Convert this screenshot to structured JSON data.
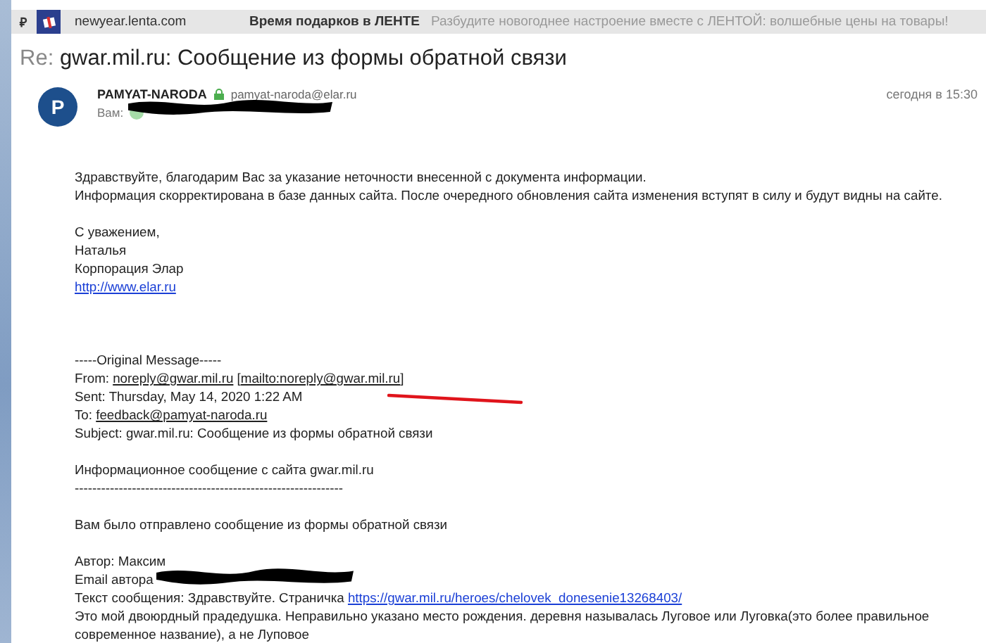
{
  "ad_bar": {
    "currency": "₽",
    "domain": "newyear.lenta.com",
    "title": "Время подарков в ЛЕНТЕ",
    "text": "Разбудите новогоднее настроение вместе с ЛЕНТОЙ: волшебные цены на товары!"
  },
  "subject": {
    "prefix": "Re:",
    "text": "gwar.mil.ru: Сообщение из формы обратной связи"
  },
  "sender": {
    "initial": "P",
    "name": "PAMYAT-NARODA",
    "email": "pamyat-naroda@elar.ru",
    "recipient_label": "Вам:",
    "recipient_redacted": true,
    "time": "сегодня в 15:30"
  },
  "body": [
    {
      "kind": "text",
      "segments": [
        {
          "kind": "plain",
          "text": "Здравствуйте, благодарим Вас за указание неточности внесенной с документа информации."
        }
      ]
    },
    {
      "kind": "text",
      "segments": [
        {
          "kind": "plain",
          "text": "Информация скорректирована в базе данных сайта. После очередного обновления сайта изменения вступят в силу и будут видны на сайте."
        }
      ]
    },
    {
      "kind": "blank"
    },
    {
      "kind": "text",
      "segments": [
        {
          "kind": "plain",
          "text": "С уважением,"
        }
      ]
    },
    {
      "kind": "text",
      "segments": [
        {
          "kind": "plain",
          "text": "Наталья"
        }
      ]
    },
    {
      "kind": "text",
      "segments": [
        {
          "kind": "plain",
          "text": "Корпорация Элар"
        }
      ]
    },
    {
      "kind": "text",
      "segments": [
        {
          "kind": "link",
          "text": "http://www.elar.ru"
        }
      ]
    },
    {
      "kind": "blank"
    },
    {
      "kind": "blank"
    },
    {
      "kind": "blank"
    },
    {
      "kind": "text",
      "segments": [
        {
          "kind": "plain",
          "text": "-----Original Message-----"
        }
      ]
    },
    {
      "kind": "text",
      "segments": [
        {
          "kind": "plain",
          "text": "From: "
        },
        {
          "kind": "mailto",
          "text": "noreply@gwar.mil.ru"
        },
        {
          "kind": "plain",
          "text": " ["
        },
        {
          "kind": "mailto",
          "text": "mailto:noreply@gwar.mil.ru"
        },
        {
          "kind": "plain",
          "text": "]"
        }
      ]
    },
    {
      "kind": "text",
      "marked": true,
      "segments": [
        {
          "kind": "plain",
          "text": "Sent: Thursday, May 14, 2020 1:22 AM"
        }
      ]
    },
    {
      "kind": "text",
      "segments": [
        {
          "kind": "plain",
          "text": "To: "
        },
        {
          "kind": "mailto",
          "text": "feedback@pamyat-naroda.ru"
        }
      ]
    },
    {
      "kind": "text",
      "segments": [
        {
          "kind": "plain",
          "text": "Subject: gwar.mil.ru: Сообщение из формы обратной связи"
        }
      ]
    },
    {
      "kind": "blank"
    },
    {
      "kind": "text",
      "segments": [
        {
          "kind": "plain",
          "text": "Информационное сообщение с сайта gwar.mil.ru"
        }
      ]
    },
    {
      "kind": "text",
      "segments": [
        {
          "kind": "plain",
          "text": "-------------------------------------------------------------"
        }
      ]
    },
    {
      "kind": "blank"
    },
    {
      "kind": "text",
      "segments": [
        {
          "kind": "plain",
          "text": "Вам было отправлено сообщение из формы обратной связи"
        }
      ]
    },
    {
      "kind": "blank"
    },
    {
      "kind": "text",
      "segments": [
        {
          "kind": "plain",
          "text": "Автор: Максим"
        }
      ]
    },
    {
      "kind": "text",
      "redacted": true,
      "segments": [
        {
          "kind": "plain",
          "text": "Email автора"
        }
      ]
    },
    {
      "kind": "text",
      "segments": [
        {
          "kind": "plain",
          "text": "Текст сообщения: Здравствуйте. Страничка "
        },
        {
          "kind": "link",
          "text": "https://gwar.mil.ru/heroes/chelovek_donesenie13268403/"
        }
      ]
    },
    {
      "kind": "text",
      "segments": [
        {
          "kind": "plain",
          "text": "Это мой двоюрдный прадедушка. Неправильно указано место рождения. деревня называлась Луговое или Луговка(это более правильное современное название), а не Луповое"
        }
      ]
    }
  ]
}
